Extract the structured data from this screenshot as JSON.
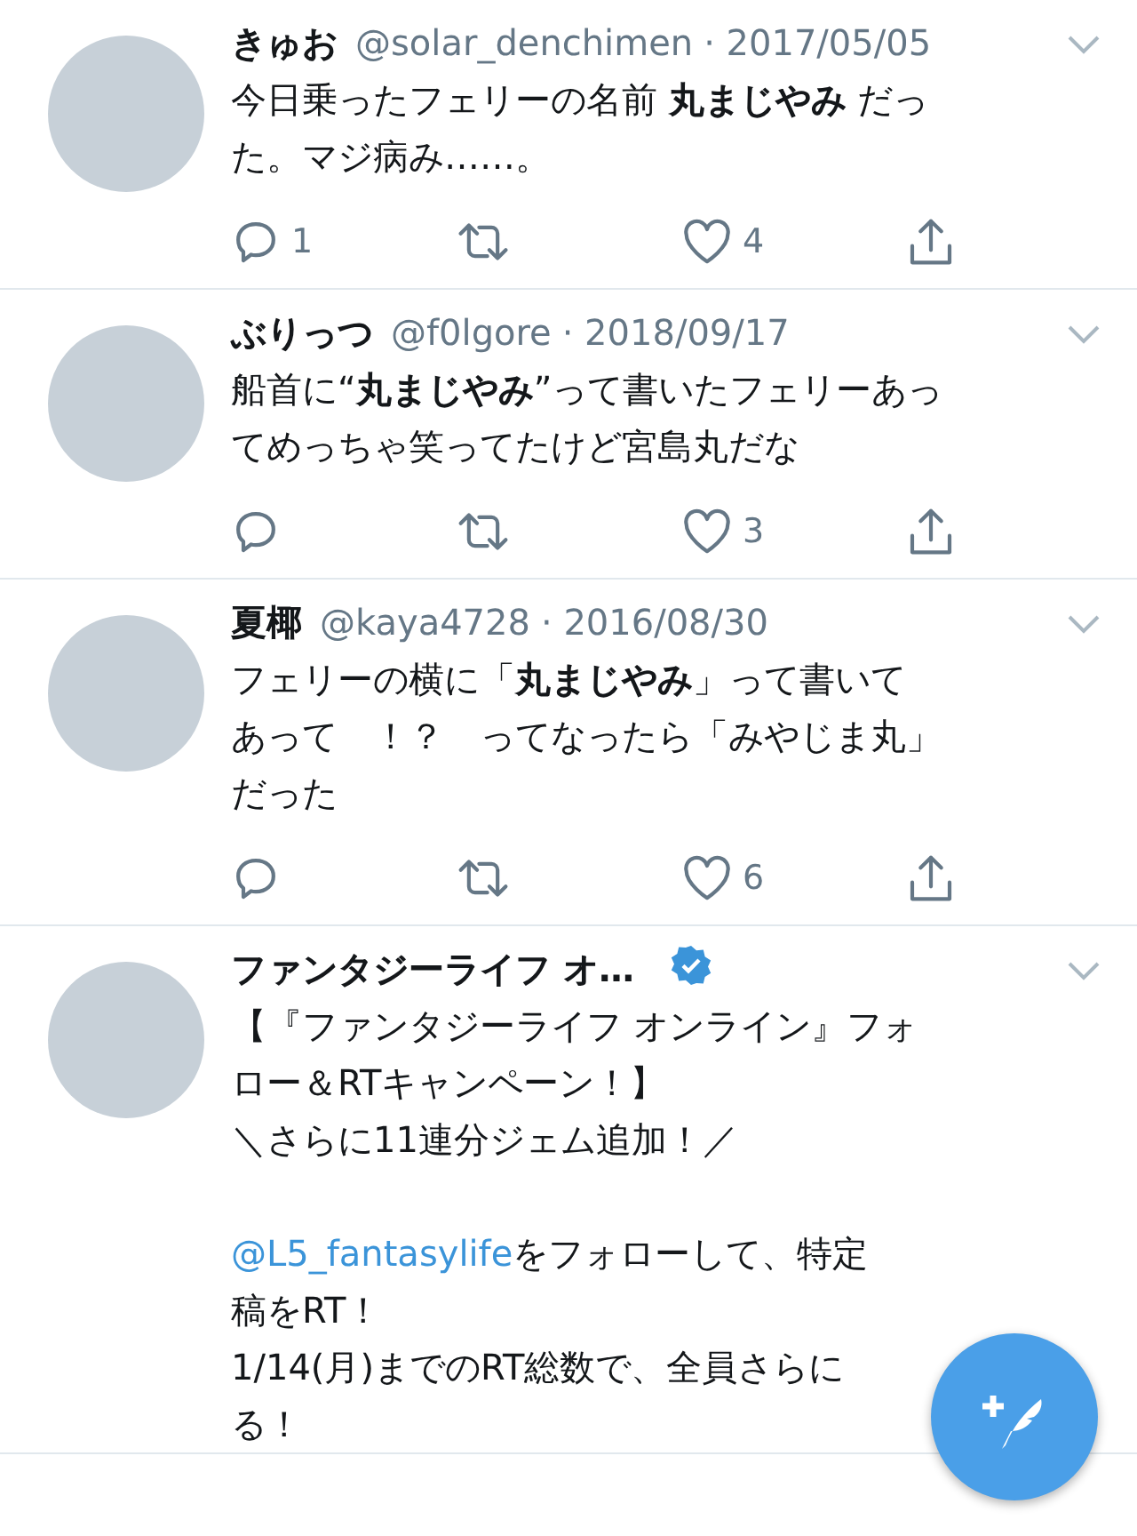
{
  "tweets": [
    {
      "name": "きゅお",
      "handle": "@solar_denchimen",
      "date": "· 2017/05/05",
      "body": [
        [
          {
            "text": "今日乗ったフェリーの名前 **丸まじやみ** だっ"
          },
          {
            "text": "た。マジ病み……。"
          }
        ]
      ],
      "reply_count": "1",
      "like_count": "4"
    },
    {
      "name": "ぶりっつ",
      "handle": "@f0lgore",
      "date": "· 2018/09/17",
      "body": [
        [
          {
            "text": "船首に“**丸まじやみ**”って書いたフェリーあっ"
          },
          {
            "text": "てめっちゃ笑ってたけど宮島丸だな"
          }
        ]
      ],
      "like_count": "3"
    },
    {
      "name": "夏椰",
      "handle": "@kaya4728",
      "date": "· 2016/08/30",
      "body": [
        [
          {
            "text": "フェリーの横に「**丸まじやみ**」って書いて"
          },
          {
            "text": "あって　！？　ってなったら「みやじま丸」"
          },
          {
            "text": "だった"
          }
        ]
      ],
      "like_count": "6"
    },
    {
      "name": "ファンタジーライフ オ…",
      "verified": true,
      "body": [
        [
          {
            "text": "【『ファンタジーライフ オンライン』フォ"
          },
          {
            "text": "ロー＆RTキャンペーン！】"
          },
          {
            "text": "＼さらに11連分ジェム追加！／"
          }
        ],
        [
          {
            "mention": "@L5_fantasylife",
            "text": "をフォローして、特定"
          },
          {
            "text": "稿をRT！"
          },
          {
            "text": "1/14(月)までのRT総数で、全員さらに"
          },
          {
            "text": "る！"
          }
        ]
      ]
    }
  ]
}
